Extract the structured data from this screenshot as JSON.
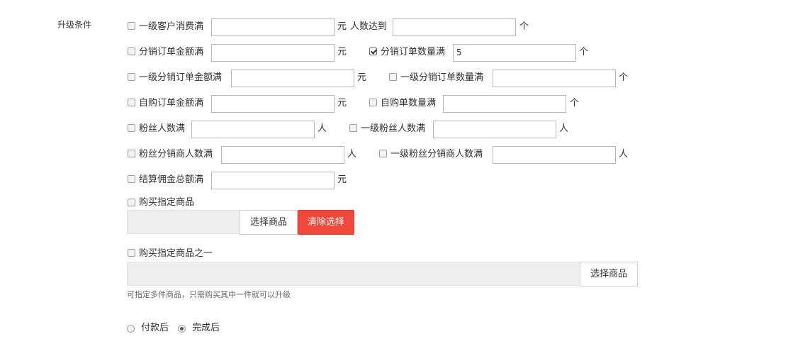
{
  "section_label": "升级条件",
  "conditions": {
    "c1": {
      "label": "一级客户消费满",
      "unit": "元",
      "value": ""
    },
    "c1b": {
      "label": "人数达到",
      "unit": "个",
      "value": ""
    },
    "c2": {
      "label": "分销订单金额满",
      "unit": "元",
      "value": ""
    },
    "c3": {
      "label": "分销订单数量满",
      "unit": "个",
      "value": "5",
      "checked": true
    },
    "c4": {
      "label": "一级分销订单金额满",
      "unit": "元",
      "value": ""
    },
    "c5": {
      "label": "一级分销订单数量满",
      "unit": "个",
      "value": ""
    },
    "c6": {
      "label": "自购订单金额满",
      "unit": "元",
      "value": ""
    },
    "c7": {
      "label": "自购单数量满",
      "unit": "个",
      "value": ""
    },
    "c8": {
      "label": "粉丝人数满",
      "unit": "人",
      "value": ""
    },
    "c9": {
      "label": "一级粉丝人数满",
      "unit": "人",
      "value": ""
    },
    "c10": {
      "label": "粉丝分销商人数满",
      "unit": "人",
      "value": ""
    },
    "c11": {
      "label": "一级粉丝分销商人数满",
      "unit": "人",
      "value": ""
    },
    "c12": {
      "label": "结算佣金总额满",
      "unit": "元",
      "value": ""
    }
  },
  "buy_product": {
    "label": "购买指定商品",
    "select_label": "选择商品",
    "clear_label": "清除选择"
  },
  "buy_one_of": {
    "label": "购买指定商品之一",
    "select_label": "选择商品",
    "hint": "可指定多件商品，只需购买其中一件就可以升级"
  },
  "timing": {
    "options": [
      "付款后",
      "完成后"
    ],
    "selected": "完成后"
  },
  "colors": {
    "accent": "#f0473b"
  }
}
